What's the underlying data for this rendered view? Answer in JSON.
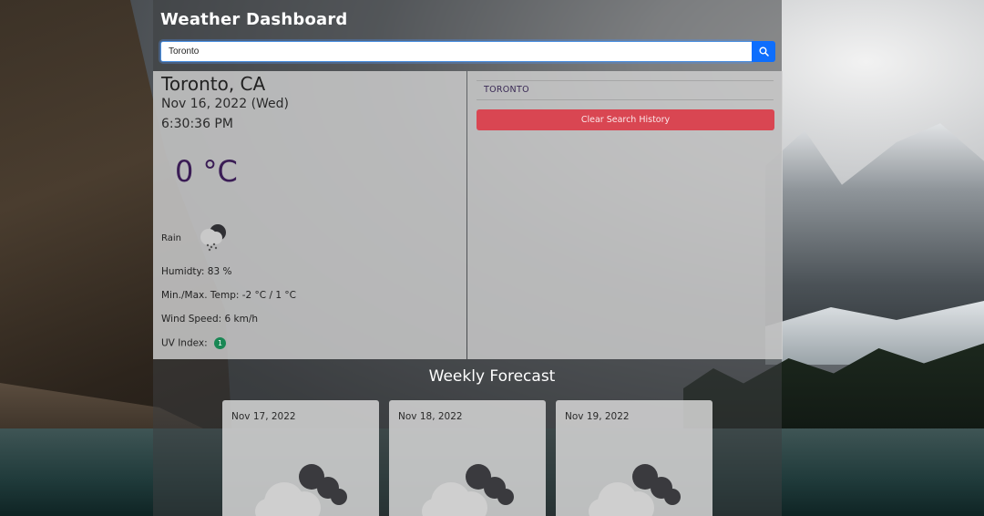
{
  "header": {
    "title": "Weather Dashboard"
  },
  "search": {
    "value": "Toronto",
    "button_icon": "search-icon"
  },
  "current": {
    "city": "Toronto, CA",
    "date": "Nov 16, 2022 (Wed)",
    "time": "6:30:36 PM",
    "temperature": "0 °C",
    "condition": "Rain",
    "condition_icon": "rain-cloud-icon",
    "humidity": "Humidty: 83 %",
    "minmax": "Min./Max. Temp: -2 °C / 1 °C",
    "wind": "Wind Speed: 6 km/h",
    "uv_label": "UV Index:",
    "uv_value": "1",
    "uv_color": "#198754"
  },
  "history": {
    "items": [
      "TORONTO"
    ],
    "clear_label": "Clear Search History",
    "clear_color": "#d94652"
  },
  "forecast": {
    "title": "Weekly Forecast",
    "days": [
      {
        "date": "Nov 17, 2022",
        "icon": "cloudy-icon"
      },
      {
        "date": "Nov 18, 2022",
        "icon": "cloudy-icon"
      },
      {
        "date": "Nov 19, 2022",
        "icon": "cloudy-icon"
      }
    ]
  },
  "colors": {
    "accent": "#0d6efd"
  }
}
